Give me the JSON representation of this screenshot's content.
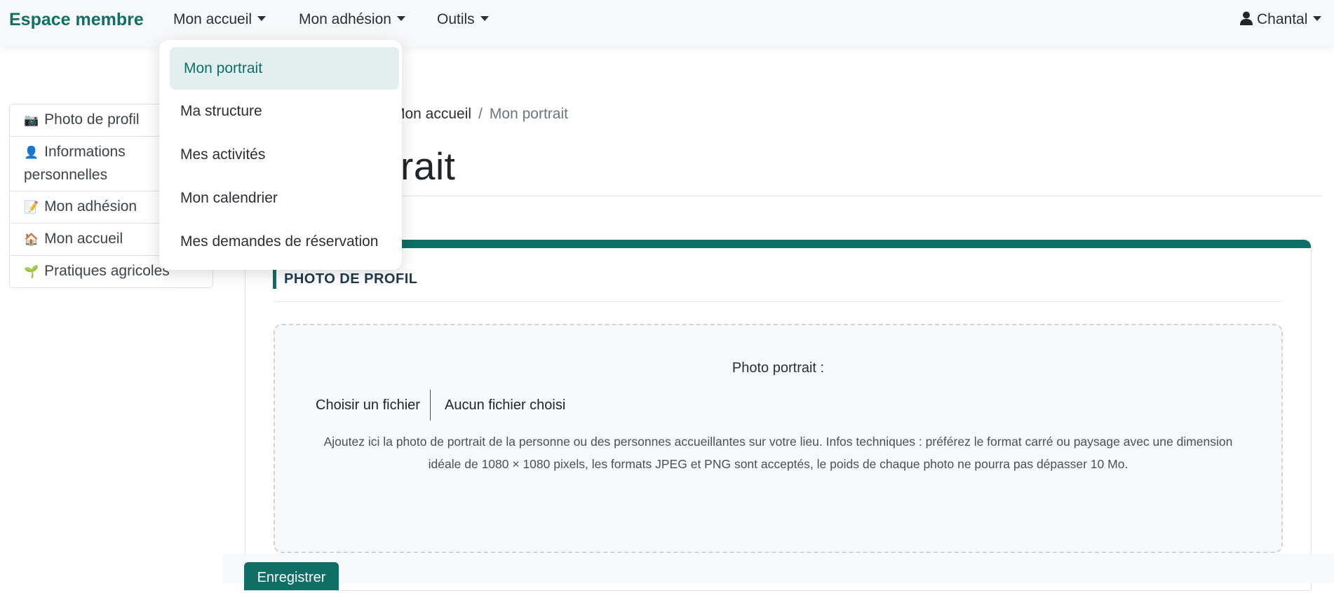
{
  "brand": "Espace membre",
  "nav": {
    "items": [
      {
        "label": "Mon accueil"
      },
      {
        "label": "Mon adhésion"
      },
      {
        "label": "Outils"
      }
    ],
    "user": "Chantal"
  },
  "dropdown": {
    "items": [
      {
        "label": "Mon portrait",
        "active": true
      },
      {
        "label": "Ma structure"
      },
      {
        "label": "Mes activités"
      },
      {
        "label": "Mon calendrier"
      },
      {
        "label": "Mes demandes de réservation"
      }
    ]
  },
  "sidebar": {
    "items": [
      {
        "icon": "📷",
        "label": "Photo de profil"
      },
      {
        "icon": "👤",
        "label": "Informations personnelles"
      },
      {
        "icon": "📝",
        "label": "Mon adhésion"
      },
      {
        "icon": "🏠",
        "label": "Mon accueil"
      },
      {
        "icon": "🌱",
        "label": "Pratiques agricoles"
      }
    ]
  },
  "breadcrumb": {
    "parent": "Mon accueil",
    "separator": "/",
    "current": "Mon portrait"
  },
  "page": {
    "title": "Mon portrait"
  },
  "section": {
    "title": "PHOTO DE PROFIL",
    "field_label": "Photo portrait :",
    "file_button": "Choisir un fichier",
    "file_status": "Aucun fichier choisi",
    "help": "Ajoutez ici la photo de portrait de la personne ou des personnes accueillantes sur votre lieu. Infos techniques : préférez le format carré ou paysage avec une dimension idéale de 1080 × 1080 pixels, les formats JPEG et PNG sont acceptés, le poids de chaque photo ne pourra pas dépasser 10 Mo."
  },
  "actions": {
    "save": "Enregistrer"
  },
  "colors": {
    "brand": "#0f6e66",
    "active_bg": "#e3efee"
  }
}
